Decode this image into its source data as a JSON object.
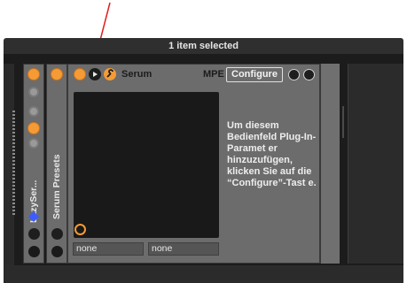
{
  "status_bar": {
    "text": "1 item selected"
  },
  "racks": {
    "lazy": {
      "label": "LazySer..."
    },
    "presets": {
      "label": "Serum Presets"
    }
  },
  "device": {
    "title": "Serum",
    "mpe_label": "MPE",
    "configure_label": "Configure",
    "info_text": "Um diesem Bedienfeld Plug-In-Paramet er hinzuzufügen, klicken Sie auf die “Configure”-Tast e.",
    "param_fields": [
      "none",
      "none"
    ]
  },
  "colors": {
    "accent": "#f59b35",
    "annotation_arrow": "#e02020",
    "device_bg": "#6c6c6c",
    "plugin_area": "#191919"
  },
  "icons": [
    "power-icon",
    "play-icon",
    "wrench-icon",
    "hot-swap-icon",
    "save-icon",
    "macro-icon",
    "chain-icon",
    "list-icon",
    "blue-diamond-icon"
  ]
}
